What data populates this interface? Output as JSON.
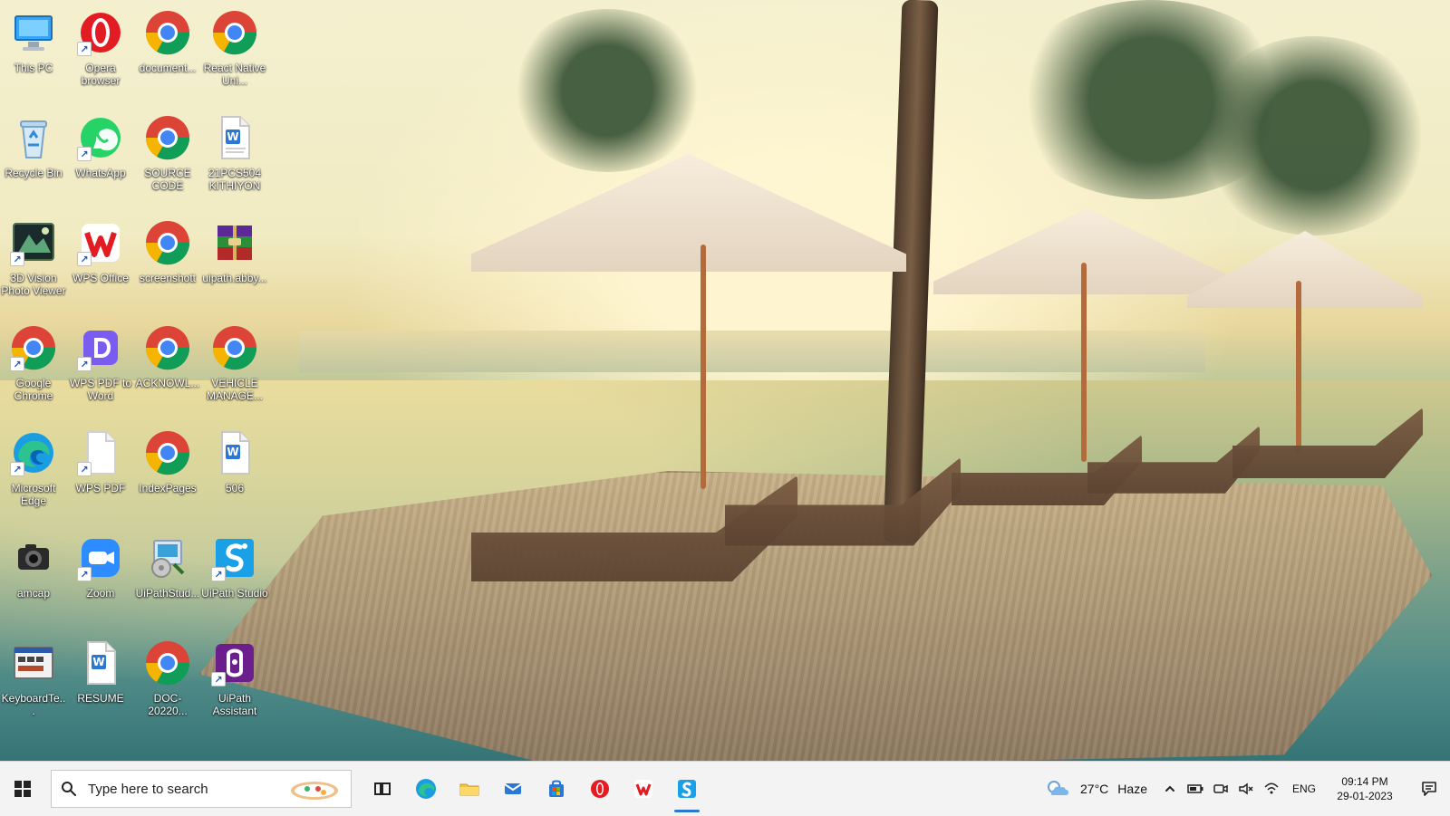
{
  "desktop": {
    "icons": [
      {
        "label": "This PC"
      },
      {
        "label": "Opera browser"
      },
      {
        "label": "document..."
      },
      {
        "label": "React Native Uni..."
      },
      {
        "label": "Recycle Bin"
      },
      {
        "label": "WhatsApp"
      },
      {
        "label": "SOURCE CODE"
      },
      {
        "label": "21PCS504 KITHIYON"
      },
      {
        "label": "3D Vision Photo Viewer"
      },
      {
        "label": "WPS Office"
      },
      {
        "label": "screenshott"
      },
      {
        "label": "uipath.abby..."
      },
      {
        "label": "Google Chrome"
      },
      {
        "label": "WPS PDF to Word"
      },
      {
        "label": "ACKNOWL..."
      },
      {
        "label": "VEHICLE MANAGE..."
      },
      {
        "label": "Microsoft Edge"
      },
      {
        "label": "WPS PDF"
      },
      {
        "label": "IndexPages"
      },
      {
        "label": "506"
      },
      {
        "label": "amcap"
      },
      {
        "label": "Zoom"
      },
      {
        "label": "UiPathStud..."
      },
      {
        "label": "UiPath Studio"
      },
      {
        "label": "KeyboardTe..."
      },
      {
        "label": "RESUME"
      },
      {
        "label": "DOC-20220..."
      },
      {
        "label": "UiPath Assistant"
      }
    ]
  },
  "taskbar": {
    "search_placeholder": "Type here to search",
    "weather_temp": "27°C",
    "weather_desc": "Haze",
    "language": "ENG",
    "time": "09:14 PM",
    "date": "29-01-2023"
  },
  "colors": {
    "taskbar_bg": "#f3f3f3",
    "accent": "#2b78d4"
  }
}
